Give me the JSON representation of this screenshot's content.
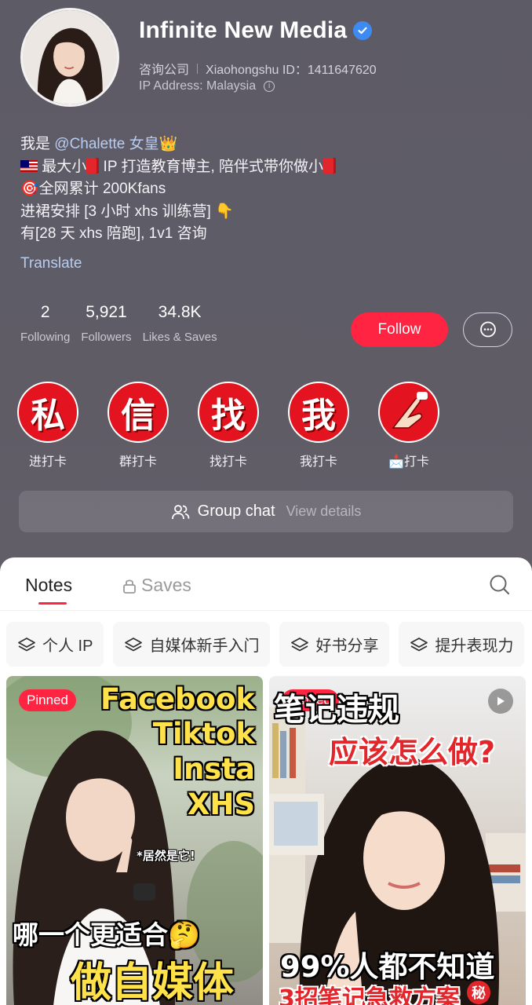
{
  "profile": {
    "name": "Infinite New Media",
    "category": "咨询公司",
    "xhs_id": "Xiaohongshu ID：1411647620",
    "ip_address": "IP Address: Malaysia",
    "bio": {
      "line1_prefix": "我是 ",
      "line1_mention": "@Chalette 女皇",
      "line1_emoji": "👑",
      "line2": " 最大小",
      "line2b": " IP 打造教育博主, 陪伴式带你做小",
      "line3_emoji": "🎯",
      "line3": "全网累计 200Kfans",
      "line4": "进裙安排 [3 小时 xhs 训练营] ",
      "line4_emoji": "👇",
      "line5": "有[28 天 xhs 陪跑], 1v1 咨询"
    },
    "translate": "Translate"
  },
  "stats": [
    {
      "value": "2",
      "label": "Following"
    },
    {
      "value": "5,921",
      "label": "Followers"
    },
    {
      "value": "34.8K",
      "label": "Likes & Saves"
    }
  ],
  "actions": {
    "follow": "Follow"
  },
  "highlights": [
    {
      "glyph": "私",
      "label": "进打卡"
    },
    {
      "glyph": "信",
      "label": "群打卡"
    },
    {
      "glyph": "找",
      "label": "找打卡"
    },
    {
      "glyph": "我",
      "label": "我打卡"
    },
    {
      "glyph": "",
      "label": "📩打卡"
    }
  ],
  "group_chat": {
    "title": "Group chat",
    "sub": "View details"
  },
  "tabs": {
    "notes": "Notes",
    "saves": "Saves"
  },
  "collections": [
    "个人 IP",
    "自媒体新手入门",
    "好书分享",
    "提升表现力"
  ],
  "cards": [
    {
      "badge": "Pinned",
      "overlay_lines": [
        "Facebook",
        "Tiktok",
        "Insta",
        "XHS"
      ],
      "small_note": "*居然是它!",
      "caption_top": "哪一个更适合🤔",
      "caption_bottom": "做自媒体"
    },
    {
      "badge": "Pinned",
      "overlay_top": "笔记违规",
      "overlay_sub": "应该怎么做?",
      "caption_top": "99%人都不知道",
      "caption_bottom": "3招笔记急救方案",
      "caption_seal": "秘"
    }
  ],
  "colors": {
    "accent": "#ff2442",
    "link": "#b6cdf0",
    "verified": "#3d8bf2"
  }
}
